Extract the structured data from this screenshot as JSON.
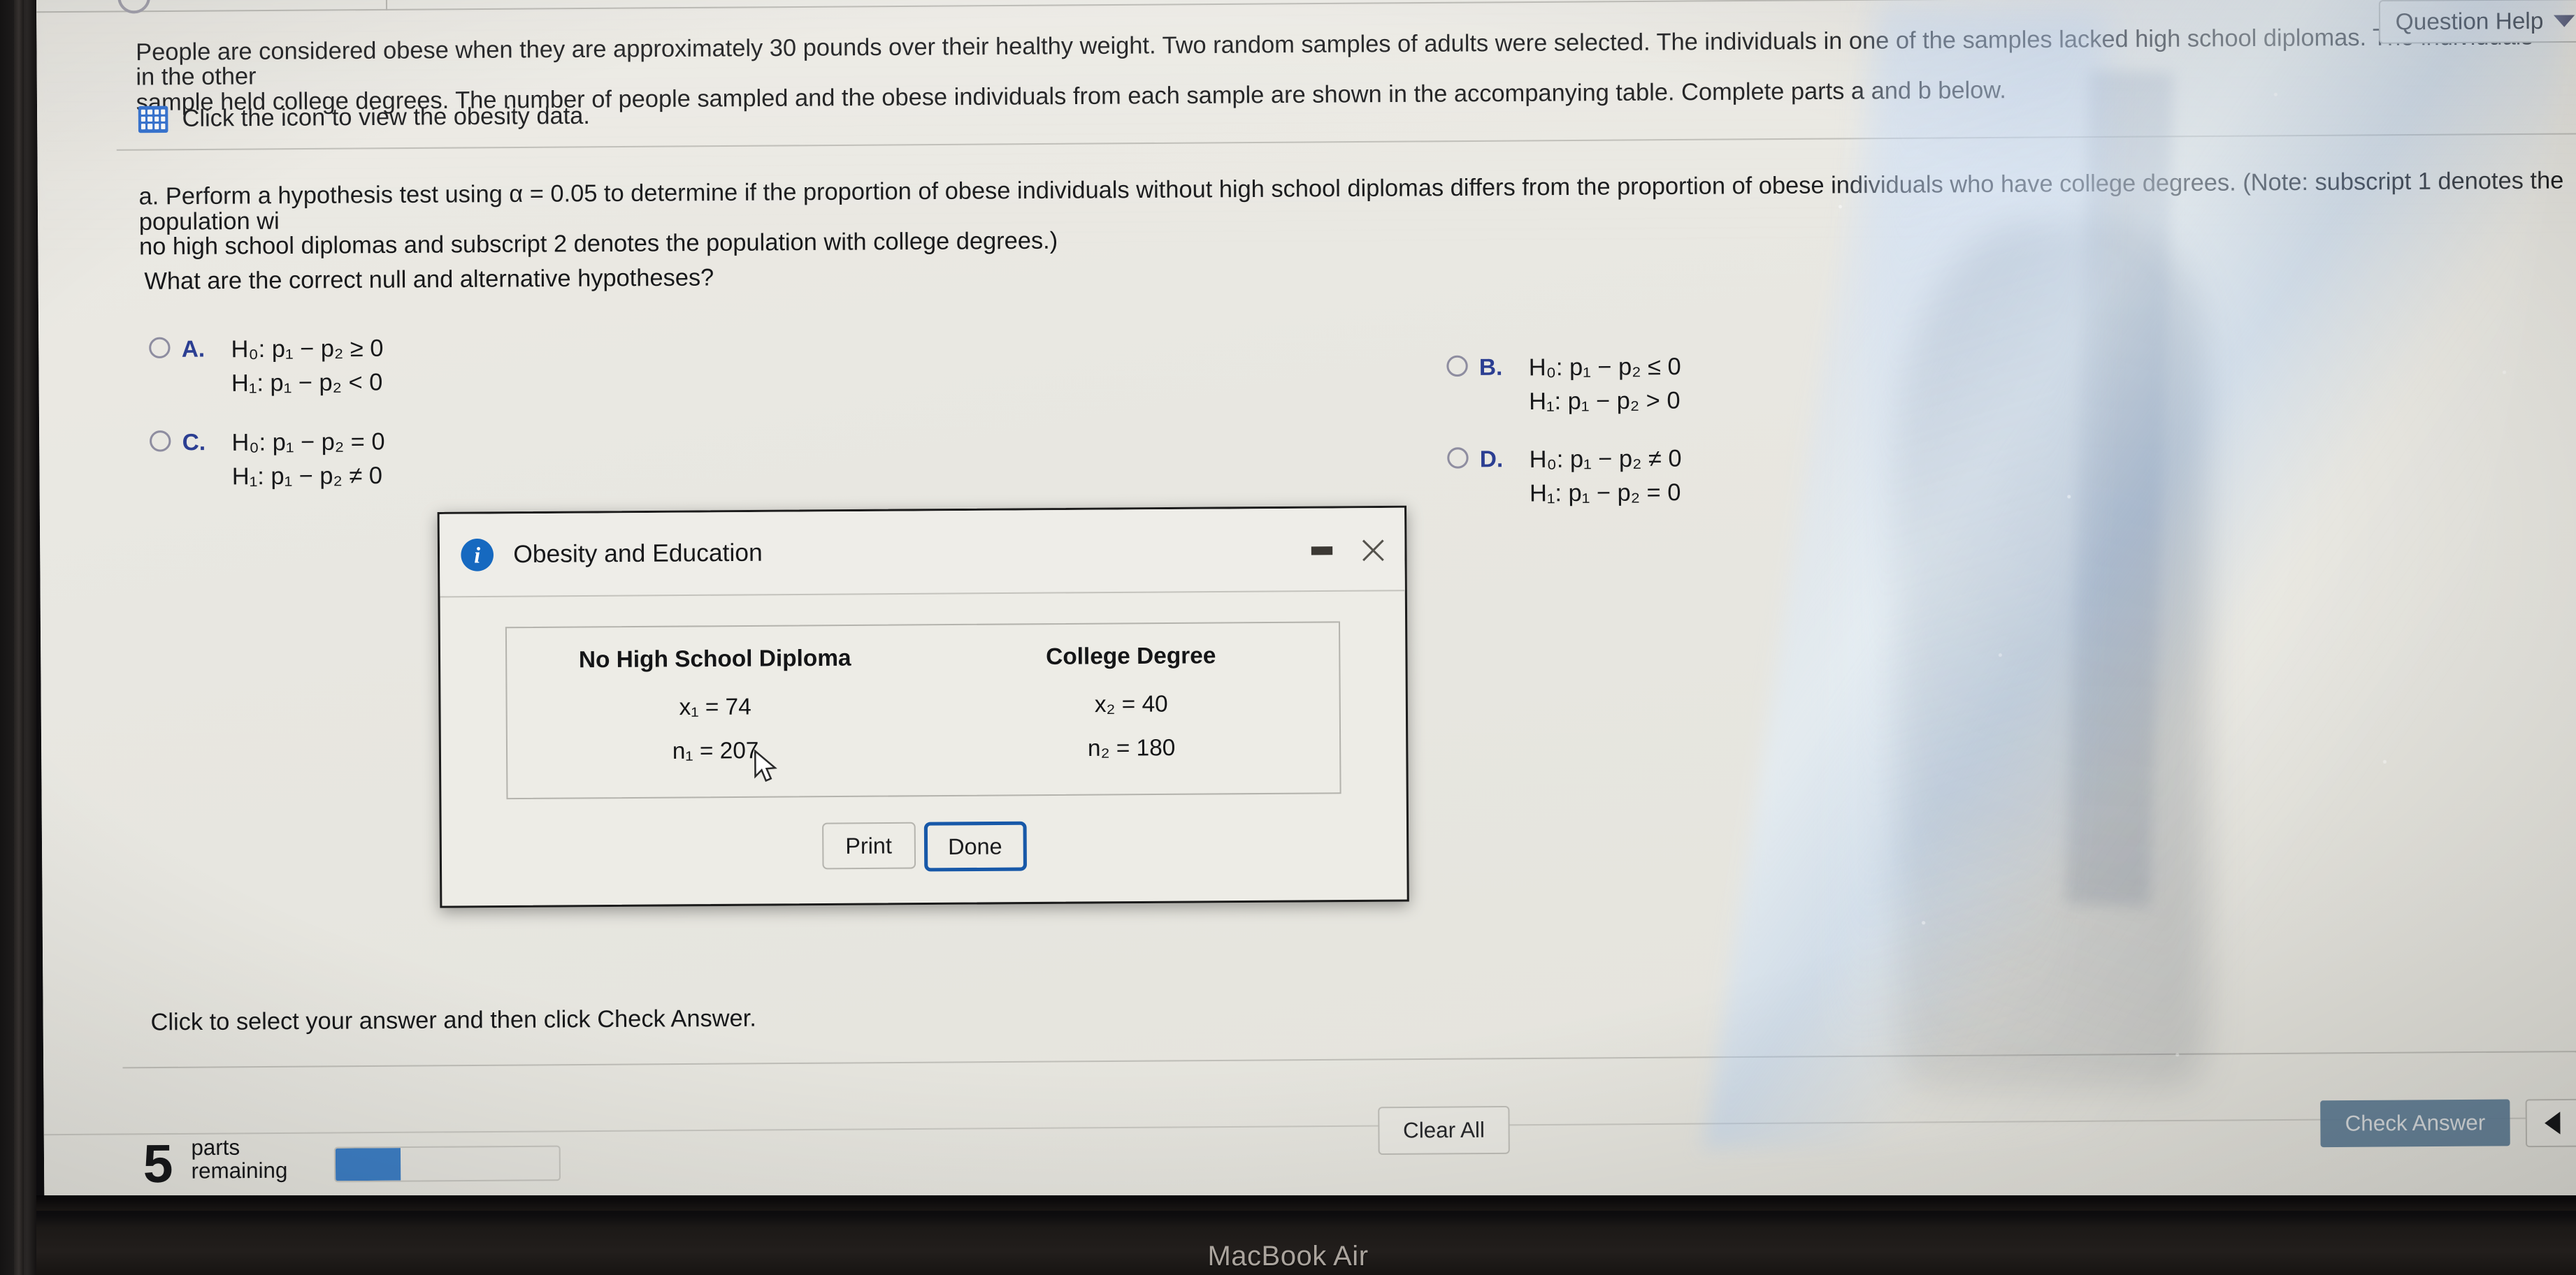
{
  "device": {
    "brand_label": "MacBook Air"
  },
  "toolbar": {
    "question_help_label": "Question Help",
    "caret_icon": "chevron-down-icon"
  },
  "problem": {
    "intro_line_1": "People are considered obese when they are approximately 30 pounds over their healthy weight. Two random samples of adults were selected. The individuals in one of the samples lacked high school diplomas. The individuals in the other",
    "intro_line_2": "sample held college degrees. The number of people sampled and the obese individuals from each sample are shown in the accompanying table. Complete parts a and b below.",
    "data_link_label": "Click the icon to view the obesity data.",
    "data_link_icon": "table-grid-icon",
    "part_a_line_1": "a. Perform a hypothesis test using α = 0.05 to determine if the proportion of obese individuals without high school diplomas differs from the proportion of obese individuals who have college degrees. (Note: subscript 1 denotes the population wi",
    "part_a_line_2": "no high school diplomas and subscript 2 denotes the population with college degrees.)",
    "question_prompt": "What are the correct null and alternative hypotheses?"
  },
  "choices": [
    {
      "letter": "A.",
      "null_hypothesis": "H₀: p₁ − p₂ ≥ 0",
      "alt_hypothesis": "H₁: p₁ − p₂ < 0",
      "selected": false
    },
    {
      "letter": "B.",
      "null_hypothesis": "H₀: p₁ − p₂ ≤ 0",
      "alt_hypothesis": "H₁: p₁ − p₂ > 0",
      "selected": false
    },
    {
      "letter": "C.",
      "null_hypothesis": "H₀: p₁ − p₂ = 0",
      "alt_hypothesis": "H₁: p₁ − p₂ ≠ 0",
      "selected": false
    },
    {
      "letter": "D.",
      "null_hypothesis": "H₀: p₁ − p₂ ≠ 0",
      "alt_hypothesis": "H₁: p₁ − p₂ = 0",
      "selected": false
    }
  ],
  "dialog": {
    "title": "Obesity and Education",
    "info_icon": "info-icon",
    "minimize_icon": "minimize-icon",
    "close_icon": "close-icon",
    "table": {
      "headers": [
        "No High School Diploma",
        "College Degree"
      ],
      "rows": [
        [
          "x₁ = 74",
          "x₂ = 40"
        ],
        [
          "n₁ = 207",
          "n₂ = 180"
        ]
      ]
    },
    "buttons": {
      "print": "Print",
      "done": "Done"
    }
  },
  "status_bar": {
    "hint": "Click to select your answer and then click Check Answer.",
    "parts_count": "5",
    "parts_label_line1": "parts",
    "parts_label_line2": "remaining",
    "progress_percent": 29,
    "clear_all_label": "Clear All",
    "check_answer_label": "Check Answer",
    "prev_icon": "triangle-left-icon",
    "next_icon": "triangle-right-icon",
    "help_badge": "?"
  },
  "colors": {
    "accent_blue": "#2b3e92",
    "link_blue": "#2b3e92",
    "progress_blue": "#3d7ec4",
    "done_border_blue": "#1758a8",
    "check_answer_bg": "#5f7e96",
    "page_bg": "#e9e9e4"
  }
}
